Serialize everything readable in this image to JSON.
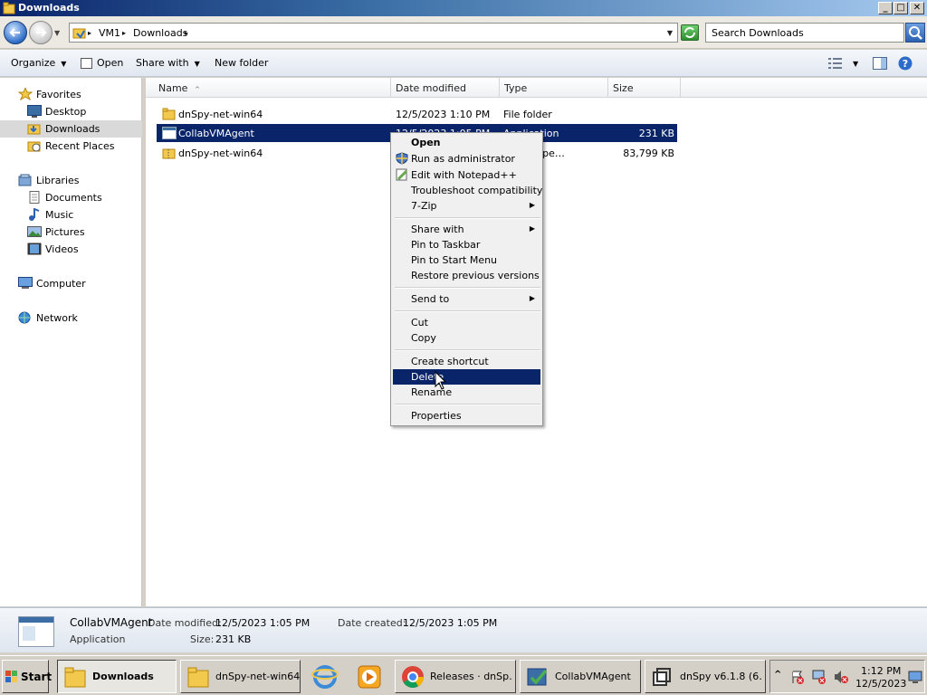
{
  "window": {
    "title": "Downloads"
  },
  "window_buttons": {
    "minimize": "_",
    "maximize": "□",
    "close": "✕"
  },
  "address": {
    "crumbs": [
      "VM1",
      "Downloads"
    ],
    "search_placeholder": "Search Downloads"
  },
  "toolbar": {
    "organize": "Organize",
    "open": "Open",
    "share_with": "Share with",
    "new_folder": "New folder"
  },
  "nav": {
    "favorites": "Favorites",
    "desktop": "Desktop",
    "downloads": "Downloads",
    "recent": "Recent Places",
    "libraries": "Libraries",
    "documents": "Documents",
    "music": "Music",
    "pictures": "Pictures",
    "videos": "Videos",
    "computer": "Computer",
    "network": "Network"
  },
  "columns": {
    "name": "Name",
    "date": "Date modified",
    "type": "Type",
    "size": "Size"
  },
  "files": [
    {
      "name": "dnSpy-net-win64",
      "date": "12/5/2023 1:10 PM",
      "type": "File folder",
      "size": ""
    },
    {
      "name": "CollabVMAgent",
      "date": "12/5/2023 1:05 PM",
      "type": "Application",
      "size": "231 KB"
    },
    {
      "name": "dnSpy-net-win64",
      "date": "",
      "type": "sed (zippe…",
      "size": "83,799 KB"
    }
  ],
  "context_menu": {
    "open": "Open",
    "run_admin": "Run as administrator",
    "notepad": "Edit with Notepad++",
    "troubleshoot": "Troubleshoot compatibility",
    "zip": "7-Zip",
    "share_with": "Share with",
    "pin_taskbar": "Pin to Taskbar",
    "pin_start": "Pin to Start Menu",
    "restore": "Restore previous versions",
    "send_to": "Send to",
    "cut": "Cut",
    "copy": "Copy",
    "create_shortcut": "Create shortcut",
    "delete": "Delete",
    "rename": "Rename",
    "properties": "Properties"
  },
  "details": {
    "name": "CollabVMAgent",
    "type": "Application",
    "date_modified_label": "Date modified:",
    "date_modified": "12/5/2023 1:05 PM",
    "date_created_label": "Date created:",
    "date_created": "12/5/2023 1:05 PM",
    "size_label": "Size:",
    "size": "231 KB"
  },
  "taskbar": {
    "start": "Start",
    "buttons": [
      "Downloads",
      "dnSpy-net-win64",
      "Releases · dnSp…",
      "CollabVMAgent",
      "dnSpy v6.1.8 (6…"
    ],
    "time": "1:12 PM",
    "date": "12/5/2023"
  }
}
